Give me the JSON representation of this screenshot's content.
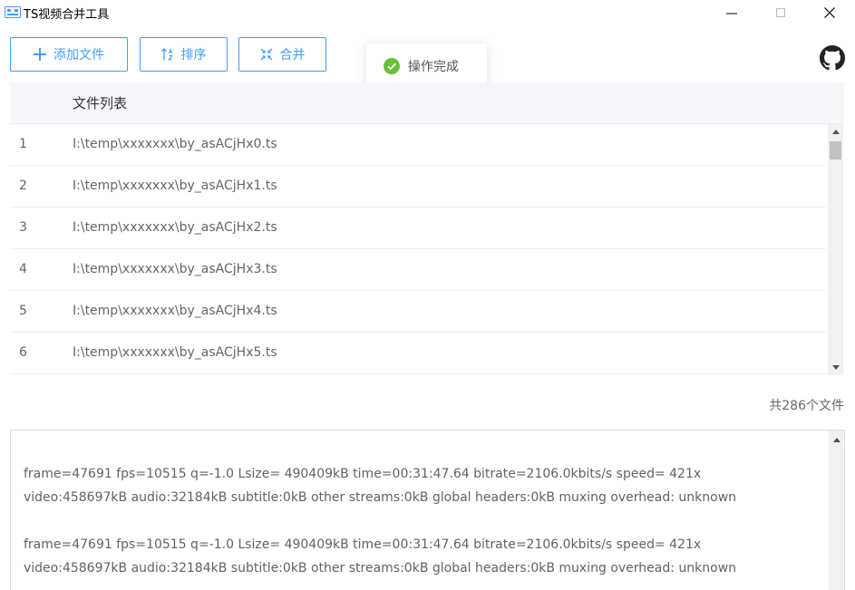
{
  "window": {
    "title": "TS视频合并工具"
  },
  "toolbar": {
    "add_label": "添加文件",
    "sort_label": "排序",
    "merge_label": "合并"
  },
  "toast": {
    "message": "操作完成"
  },
  "table": {
    "header": "文件列表",
    "rows": [
      {
        "index": "1",
        "path": "I:\\temp\\xxxxxxx\\by_asACjHx0.ts"
      },
      {
        "index": "2",
        "path": "I:\\temp\\xxxxxxx\\by_asACjHx1.ts"
      },
      {
        "index": "3",
        "path": "I:\\temp\\xxxxxxx\\by_asACjHx2.ts"
      },
      {
        "index": "4",
        "path": "I:\\temp\\xxxxxxx\\by_asACjHx3.ts"
      },
      {
        "index": "5",
        "path": "I:\\temp\\xxxxxxx\\by_asACjHx4.ts"
      },
      {
        "index": "6",
        "path": "I:\\temp\\xxxxxxx\\by_asACjHx5.ts"
      }
    ]
  },
  "summary": {
    "count_text": "共286个文件"
  },
  "log": {
    "lines": [
      "frame=47691 fps=10515 q=-1.0 Lsize=  490409kB time=00:31:47.64 bitrate=2106.0kbits/s speed= 421x",
      "video:458697kB audio:32184kB subtitle:0kB other streams:0kB global headers:0kB muxing overhead: unknown",
      "",
      "frame=47691 fps=10515 q=-1.0 Lsize=  490409kB time=00:31:47.64 bitrate=2106.0kbits/s speed= 421x",
      "video:458697kB audio:32184kB subtitle:0kB other streams:0kB global headers:0kB muxing overhead: unknown"
    ]
  },
  "colors": {
    "accent": "#409eff",
    "success": "#67c23a",
    "header_bg": "#f5f7fa"
  },
  "icons": {
    "app": "film-icon",
    "add": "plus-icon",
    "sort": "sort-icon",
    "merge": "merge-icon",
    "toast": "check-circle-icon",
    "github": "github-icon"
  }
}
